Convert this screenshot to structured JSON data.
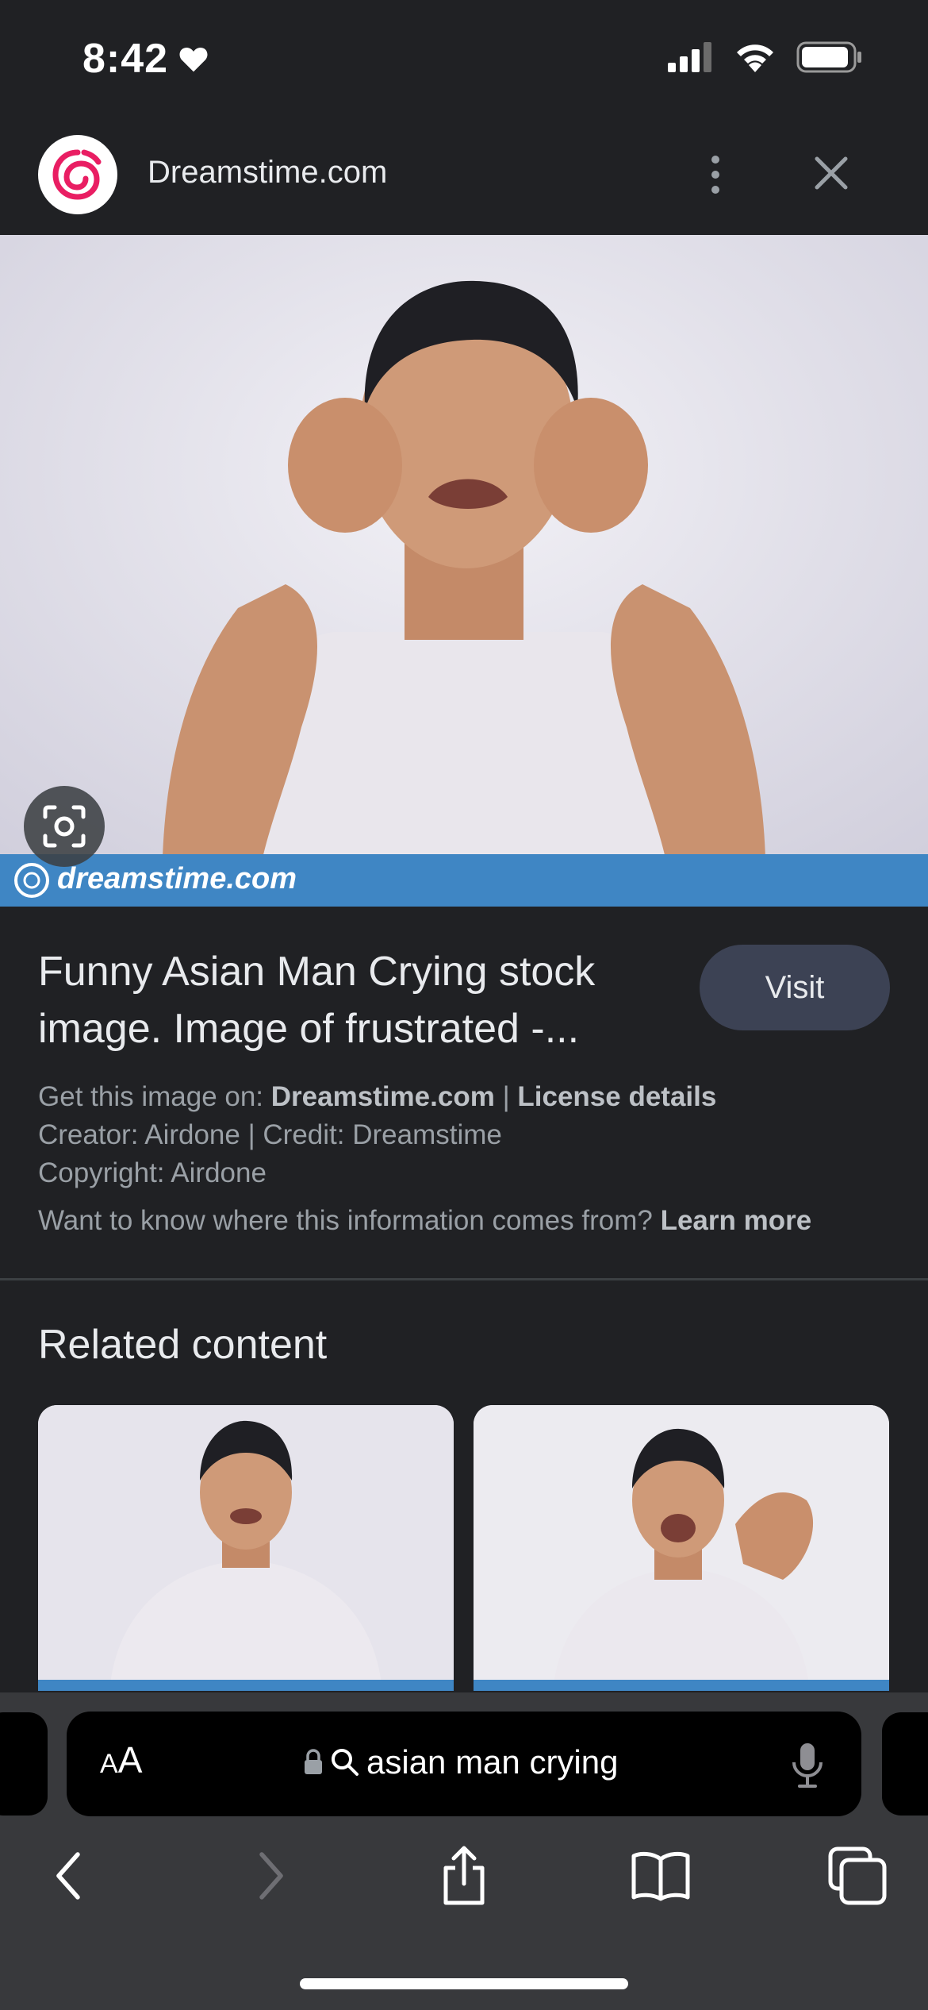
{
  "status_bar": {
    "time": "8:42",
    "icons": [
      "heart-icon",
      "signal-icon",
      "wifi-icon",
      "battery-icon"
    ]
  },
  "header": {
    "site_name": "Dreamstime.com",
    "icons": [
      "dreamstime-logo",
      "more-vert-icon",
      "close-icon"
    ]
  },
  "main_image": {
    "description_icon": "lens-icon",
    "watermark": "dreamstime.com"
  },
  "result": {
    "title_line1": "Funny Asian Man Crying stock",
    "title_line2": "image. Image of frustrated -...",
    "visit_label": "Visit",
    "get_prefix": "Get this image on: ",
    "get_source": "Dreamstime.com",
    "separator": " | ",
    "license": "License details",
    "creator_line": "Creator: Airdone | Credit: Dreamstime",
    "copyright_line": "Copyright: Airdone",
    "info_prefix": "Want to know where this information comes from? ",
    "learn_more": "Learn more"
  },
  "related": {
    "title": "Related content"
  },
  "browser": {
    "aa_label_small": "A",
    "aa_label_large": "A",
    "url": "asian man crying",
    "nav_icons": [
      "back-icon",
      "forward-icon",
      "share-icon",
      "bookmarks-icon",
      "tabs-icon"
    ]
  },
  "colors": {
    "background": "#202124",
    "visit_button": "#3c4254",
    "toolbar": "#38393c",
    "brand_pink": "#e91e63"
  }
}
